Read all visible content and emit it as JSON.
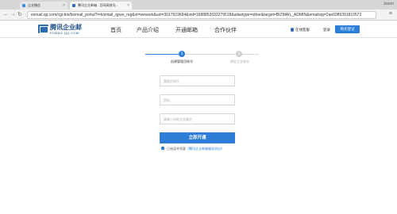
{
  "browser": {
    "tabs": [
      {
        "label": "企业微信"
      },
      {
        "label": "腾讯企业邮箱 - 官网高效沟..."
      }
    ],
    "window_user": "Jason",
    "url": "exmail.qq.com/cgi-bin/bizmail_portal?t=bizmail_qywx_reg&vt=wework&uin=3017919694&vid=1688852033279518&aliastype=other&target=BIZMAIL_ADMIN&emailsig=2ae6089391810572"
  },
  "header": {
    "logo_title": "腾讯企业邮",
    "logo_subtitle": "EXMAIL.QQ.COM",
    "nav": [
      "首页",
      "产品介绍",
      "开通邮箱",
      "合作伙伴"
    ],
    "service_label": "在线客服",
    "login_label": "登录",
    "buy_label": "购买登记"
  },
  "steps": [
    {
      "number": "1",
      "label": "创建管理员帐号"
    },
    {
      "number": "2",
      "label": "绑定企业域名"
    }
  ],
  "form": {
    "account_placeholder": "管理员帐号",
    "password_placeholder": "密码",
    "confirm_placeholder": "请输入你的企业域名",
    "submit_label": "立即开通",
    "agree_prefix": "已阅读并同意",
    "agree_link": "《腾讯企业邮箱服务协议》"
  }
}
